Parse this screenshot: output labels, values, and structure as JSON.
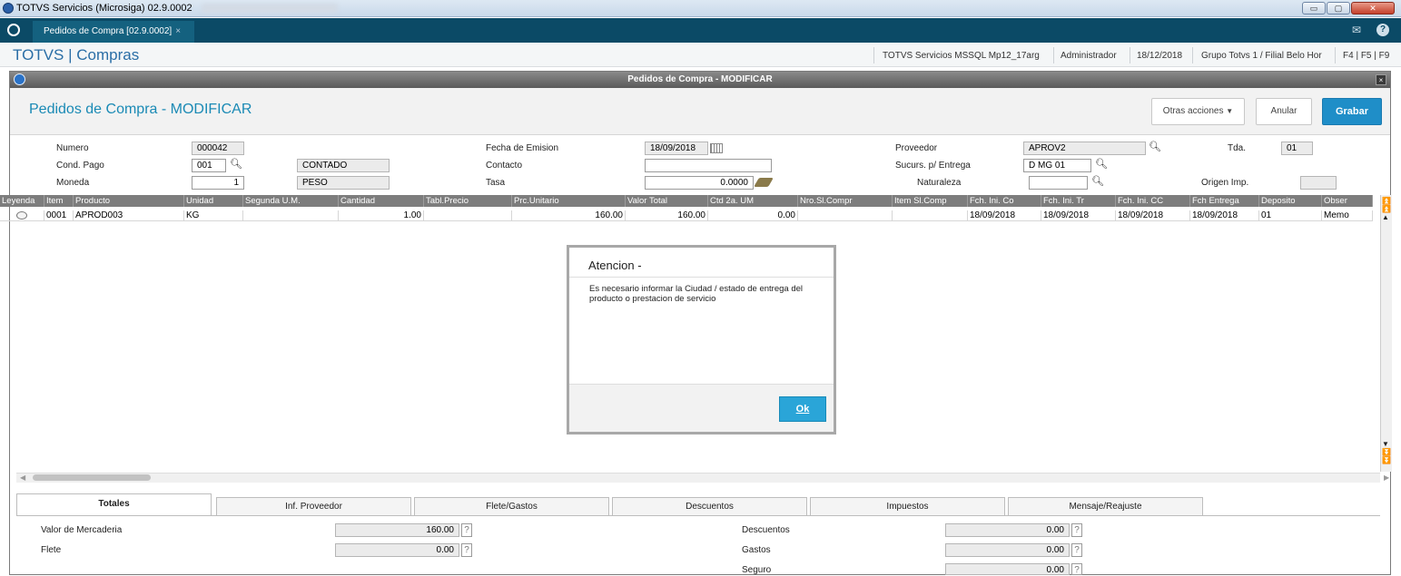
{
  "os_window": {
    "title": "TOTVS Servicios (Microsiga) 02.9.0002",
    "title_suffix_blurred": "TOTVS Developer Studio 11.3",
    "min_label": "▭",
    "max_label": "▢",
    "close_label": "✕"
  },
  "tab": {
    "label": "Pedidos de Compra [02.9.0002]",
    "close": "×"
  },
  "header_icons": {
    "mail": "✉",
    "help": "?"
  },
  "app_header": {
    "brand": "TOTVS | Compras",
    "server": "TOTVS Servicios MSSQL Mp12_17arg",
    "user": "Administrador",
    "date": "18/12/2018",
    "branch": "Grupo Totvs 1 / Filial Belo Hor",
    "keys": "F4 | F5 | F9"
  },
  "window": {
    "title": "Pedidos de Compra - MODIFICAR",
    "close": "×",
    "form_title": "Pedidos de Compra - MODIFICAR",
    "buttons": {
      "other": "Otras acciones",
      "cancel": "Anular",
      "save": "Grabar"
    }
  },
  "form": {
    "numero": {
      "label": "Numero",
      "value": "000042"
    },
    "cond_pago": {
      "label": "Cond. Pago",
      "value": "001",
      "desc": "CONTADO"
    },
    "moneda": {
      "label": "Moneda",
      "value": "1",
      "desc": "PESO"
    },
    "fecha_emision": {
      "label": "Fecha de Emision",
      "value": "18/09/2018"
    },
    "contacto": {
      "label": "Contacto",
      "value": ""
    },
    "tasa": {
      "label": "Tasa",
      "value": "0.0000"
    },
    "proveedor": {
      "label": "Proveedor",
      "value": "APROV2"
    },
    "tda": {
      "label": "Tda.",
      "value": "01"
    },
    "sucursal": {
      "label": "Sucurs. p/ Entrega",
      "value": "D MG 01"
    },
    "naturaleza": {
      "label": "Naturaleza",
      "value": ""
    },
    "origen": {
      "label": "Origen Imp.",
      "value": ""
    }
  },
  "grid": {
    "columns": [
      "Leyenda",
      "Item",
      "Producto",
      "Unidad",
      "Segunda U.M.",
      "Cantidad",
      "Tabl.Precio",
      "Prc.Unitario",
      "Valor Total",
      "Ctd 2a. UM",
      "Nro.Sl.Compr",
      "Item Sl.Comp",
      "Fch. Ini. Co",
      "Fch. Ini. Tr",
      "Fch. Ini. CC",
      "Fch Entrega",
      "Deposito",
      "Obser"
    ],
    "rows": [
      {
        "item": "0001",
        "producto": "APROD003",
        "unidad": "KG",
        "segunda_um": "",
        "cantidad": "1.00",
        "tabl_precio": "",
        "prc_unitario": "160.00",
        "valor_total": "160.00",
        "ctd_2a": "0.00",
        "nro_sl": "",
        "item_sl": "",
        "fch_ini_co": "18/09/2018",
        "fch_ini_tr": "18/09/2018",
        "fch_ini_cc": "18/09/2018",
        "fch_entrega": "18/09/2018",
        "deposito": "01",
        "obser": "Memo"
      }
    ]
  },
  "dialog": {
    "title": "Atencion -",
    "message": "Es necesario informar la Ciudad / estado de entrega del producto o prestacion de servicio",
    "ok": "Ok"
  },
  "bottom_tabs": [
    "Totales",
    "Inf. Proveedor",
    "Flete/Gastos",
    "Descuentos",
    "Impuestos",
    "Mensaje/Reajuste"
  ],
  "totals": {
    "valor_mercaderia": {
      "label": "Valor de Mercaderia",
      "value": "160.00"
    },
    "flete": {
      "label": "Flete",
      "value": "0.00"
    },
    "descuentos": {
      "label": "Descuentos",
      "value": "0.00"
    },
    "gastos": {
      "label": "Gastos",
      "value": "0.00"
    },
    "seguro": {
      "label": "Seguro",
      "value": "0.00"
    },
    "help": "?"
  }
}
